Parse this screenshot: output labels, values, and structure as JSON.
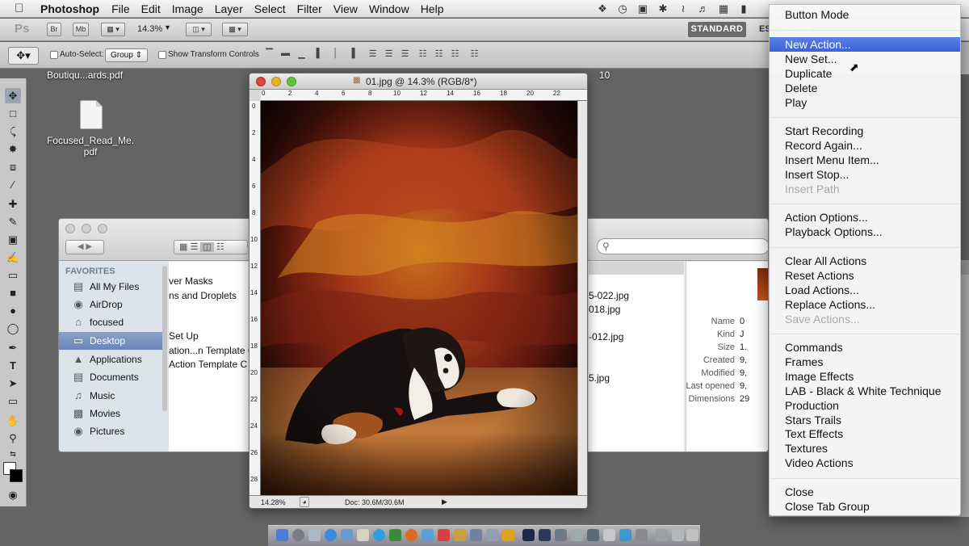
{
  "menubar": {
    "app_name": "Photoshop",
    "items": [
      "File",
      "Edit",
      "Image",
      "Layer",
      "Select",
      "Filter",
      "View",
      "Window",
      "Help"
    ]
  },
  "appbar": {
    "zoom": "14.3%",
    "bridge_label": "Br",
    "minibridge_label": "Mb",
    "workspace": "STANDARD",
    "essentials": "ESSENTIALS"
  },
  "options": {
    "auto_select_label": "Auto-Select:",
    "group_value": "Group",
    "transform_label": "Show Transform Controls"
  },
  "desktop": {
    "top_label": "Boutiqu...ards.pdf",
    "icon_label_1": "Focused_Read_Me.",
    "icon_label_2": "pdf",
    "right_label": "10"
  },
  "finder": {
    "favorites_header": "FAVORITES",
    "sidebar": [
      "All My Files",
      "AirDrop",
      "focused",
      "Desktop",
      "Applications",
      "Documents",
      "Music",
      "Movies",
      "Pictures"
    ],
    "col1": [
      "ver Masks",
      "ns and Droplets",
      "",
      "Set Up",
      "ation...n Template C",
      "Action Template C"
    ],
    "col2": [
      "5-022.jpg",
      "018.jpg",
      "",
      "-012.jpg",
      "",
      "",
      "5.jpg"
    ],
    "info_labels": [
      "Name",
      "Kind",
      "Size",
      "Created",
      "Modified",
      "Last opened",
      "Dimensions"
    ],
    "info_values": [
      "0",
      "J",
      "1.",
      "9,",
      "9,",
      "9,",
      "29"
    ]
  },
  "document": {
    "title": "01.jpg @ 14.3% (RGB/8*)",
    "ruler_h": [
      "0",
      "2",
      "4",
      "6",
      "8",
      "10",
      "12",
      "14",
      "16",
      "18",
      "20",
      "22"
    ],
    "ruler_v": [
      "0",
      "2",
      "4",
      "6",
      "8",
      "10",
      "12",
      "14",
      "16",
      "18",
      "20",
      "22",
      "24",
      "26",
      "28"
    ],
    "zoom": "14.28%",
    "doc_size": "Doc: 30.6M/30.6M"
  },
  "menu": {
    "items": [
      {
        "label": "Button Mode",
        "state": "normal"
      },
      {
        "label": "New Action...",
        "state": "highlighted"
      },
      {
        "label": "New Set...",
        "state": "normal"
      },
      {
        "label": "Duplicate",
        "state": "normal"
      },
      {
        "label": "Delete",
        "state": "normal"
      },
      {
        "label": "Play",
        "state": "normal"
      },
      {
        "label": "Start Recording",
        "state": "normal"
      },
      {
        "label": "Record Again...",
        "state": "normal"
      },
      {
        "label": "Insert Menu Item...",
        "state": "normal"
      },
      {
        "label": "Insert Stop...",
        "state": "normal"
      },
      {
        "label": "Insert Path",
        "state": "disabled"
      },
      {
        "label": "Action Options...",
        "state": "normal"
      },
      {
        "label": "Playback Options...",
        "state": "normal"
      },
      {
        "label": "Clear All Actions",
        "state": "normal"
      },
      {
        "label": "Reset Actions",
        "state": "normal"
      },
      {
        "label": "Load Actions...",
        "state": "normal"
      },
      {
        "label": "Replace Actions...",
        "state": "normal"
      },
      {
        "label": "Save Actions...",
        "state": "disabled"
      },
      {
        "label": "Commands",
        "state": "normal"
      },
      {
        "label": "Frames",
        "state": "normal"
      },
      {
        "label": "Image Effects",
        "state": "normal"
      },
      {
        "label": "LAB - Black & White Technique",
        "state": "normal"
      },
      {
        "label": "Production",
        "state": "normal"
      },
      {
        "label": "Stars Trails",
        "state": "normal"
      },
      {
        "label": "Text Effects",
        "state": "normal"
      },
      {
        "label": "Textures",
        "state": "normal"
      },
      {
        "label": "Video Actions",
        "state": "normal"
      },
      {
        "label": "Close",
        "state": "normal"
      },
      {
        "label": "Close Tab Group",
        "state": "normal"
      }
    ]
  },
  "colors": {
    "highlight": "#3a62da",
    "finder_selection": "#6a86b6",
    "workspace_button": "#6b6b6b"
  }
}
